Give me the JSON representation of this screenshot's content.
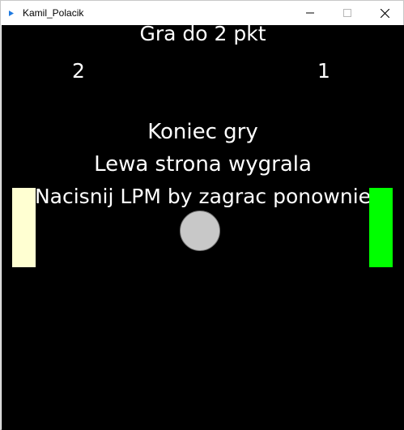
{
  "window": {
    "title": "Kamil_Polacik"
  },
  "game": {
    "header": "Gra do 2 pkt",
    "score_left": "2",
    "score_right": "1",
    "message_line1": "Koniec gry",
    "message_line2": "Lewa strona wygrala",
    "message_line3": "Nacisnij LPM by zagrac ponownie"
  },
  "colors": {
    "background": "#000000",
    "text": "#ffffff",
    "left_paddle": "#ffffd2",
    "right_paddle": "#00ff00",
    "ball": "#c8c8c8"
  },
  "icons": {
    "app": "app-icon",
    "minimize": "minimize-icon",
    "maximize": "maximize-icon",
    "close": "close-icon"
  }
}
